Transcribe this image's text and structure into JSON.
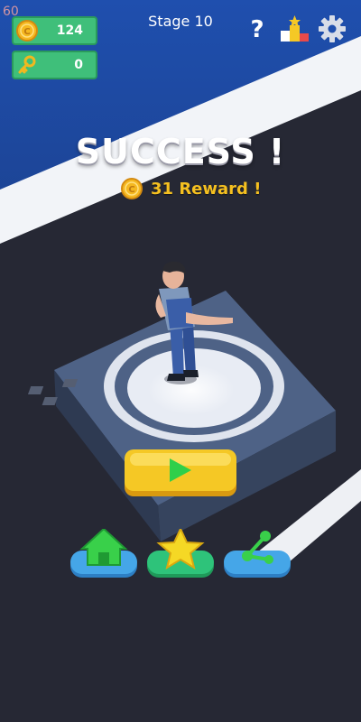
{
  "hud": {
    "coins": "124",
    "keys": "0",
    "fps": "60",
    "stage": "Stage 10"
  },
  "result": {
    "title": "SUCCESS !",
    "reward": "31 Reward !"
  },
  "icons": {
    "coin": "coin-icon",
    "key": "key-icon",
    "help": "question-icon",
    "leaderboard": "podium-icon",
    "settings": "gear-icon",
    "play": "play-icon",
    "home": "home-icon",
    "rate": "star-icon",
    "share": "share-icon"
  },
  "colors": {
    "hud_green": "#3fbf7a",
    "play_yellow": "#f5c825",
    "home_green": "#39d04a",
    "star_yellow": "#f5d825",
    "share_green": "#39d04a",
    "button_base_blue": "#45a6e8",
    "button_base_green": "#2ec37a"
  }
}
